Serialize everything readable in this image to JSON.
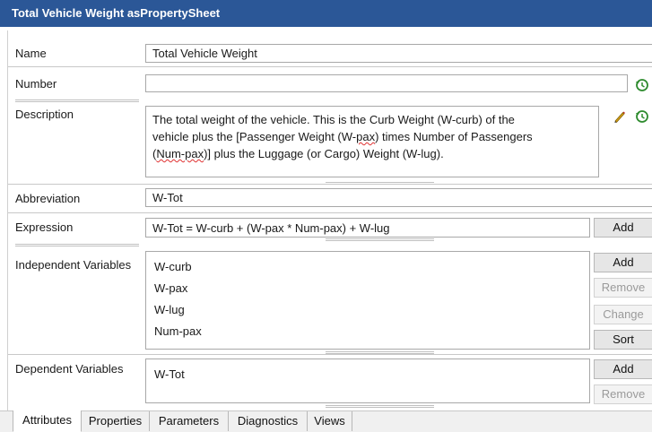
{
  "window": {
    "title": "Total Vehicle Weight asPropertySheet"
  },
  "fields": {
    "name": {
      "label": "Name",
      "value": "Total Vehicle Weight"
    },
    "number": {
      "label": "Number",
      "value": ""
    },
    "description": {
      "label": "Description",
      "line1": "The total weight of the vehicle.  This is the Curb Weight (W-curb) of the",
      "line2_a": "vehicle plus the [Passenger Weight (W-",
      "line2_b": "pax",
      "line2_c": ") times Number of Passengers",
      "line3_a": "(",
      "line3_b": "Num-pax",
      "line3_c": ")] plus the Luggage (or Cargo)  Weight (W-lug)."
    },
    "abbreviation": {
      "label": "Abbreviation",
      "value": "W-Tot"
    },
    "expression": {
      "label": "Expression",
      "value": "W-Tot = W-curb + (W-pax * Num-pax) + W-lug",
      "add_label": "Add"
    },
    "independent_variables": {
      "label": "Independent Variables",
      "items": [
        "W-curb",
        "W-pax",
        "W-lug",
        "Num-pax"
      ],
      "buttons": {
        "add": "Add",
        "remove": "Remove",
        "change": "Change",
        "sort": "Sort"
      }
    },
    "dependent_variables": {
      "label": "Dependent Variables",
      "items": [
        "W-Tot"
      ],
      "buttons": {
        "add": "Add",
        "remove": "Remove"
      }
    }
  },
  "tabs": [
    {
      "label": "Attributes",
      "active": true
    },
    {
      "label": "Properties",
      "active": false
    },
    {
      "label": "Parameters",
      "active": false
    },
    {
      "label": "Diagnostics",
      "active": false
    },
    {
      "label": "Views",
      "active": false
    }
  ],
  "colors": {
    "titlebar": "#2b5797",
    "history_icon": "#2e8b2e",
    "pencil": "#d4a017"
  }
}
